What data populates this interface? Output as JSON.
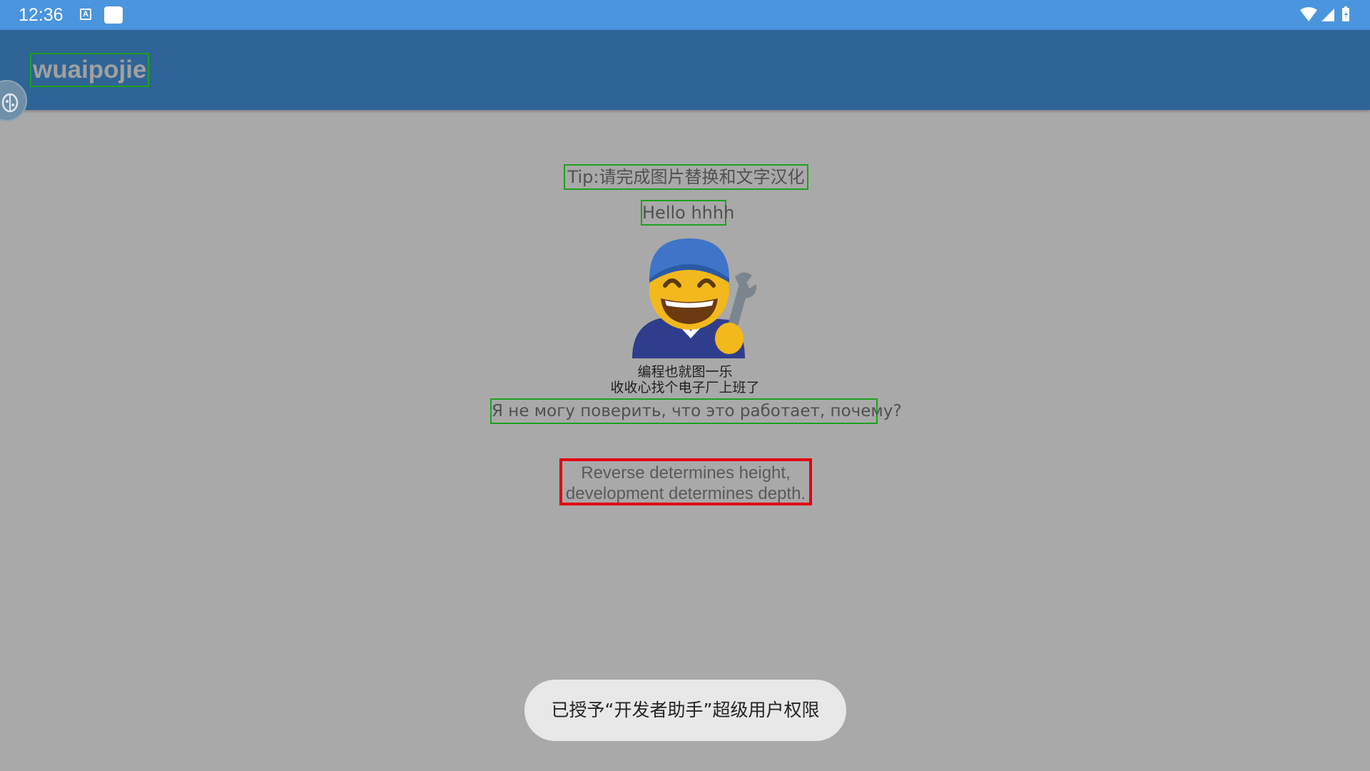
{
  "status_bar": {
    "time": "12:36",
    "notification_icons": [
      "text-a-icon",
      "square-icon"
    ],
    "system_icons": [
      "wifi-icon",
      "signal-icon",
      "battery-icon"
    ]
  },
  "app_bar": {
    "title": "wuaipojie",
    "color": "#2e6496"
  },
  "content": {
    "tip": "Tip:请完成图片替换和文字汉化",
    "hello": "Hello hhhh",
    "image_icon": "mechanic-emoji-icon",
    "caption_line1": "编程也就图一乐",
    "caption_line2": "收收心找个电子厂上班了",
    "russian": "Я не могу поверить, что это работает, почему?",
    "quote_line1": "Reverse determines height,",
    "quote_line2": "development determines depth."
  },
  "toast": {
    "message": "已授予“开发者助手”超级用户权限"
  },
  "colors": {
    "status_bar": "#4a95de",
    "background": "#a9a9a9",
    "highlight_green": "#1ea11e",
    "highlight_red": "#e3000f"
  }
}
